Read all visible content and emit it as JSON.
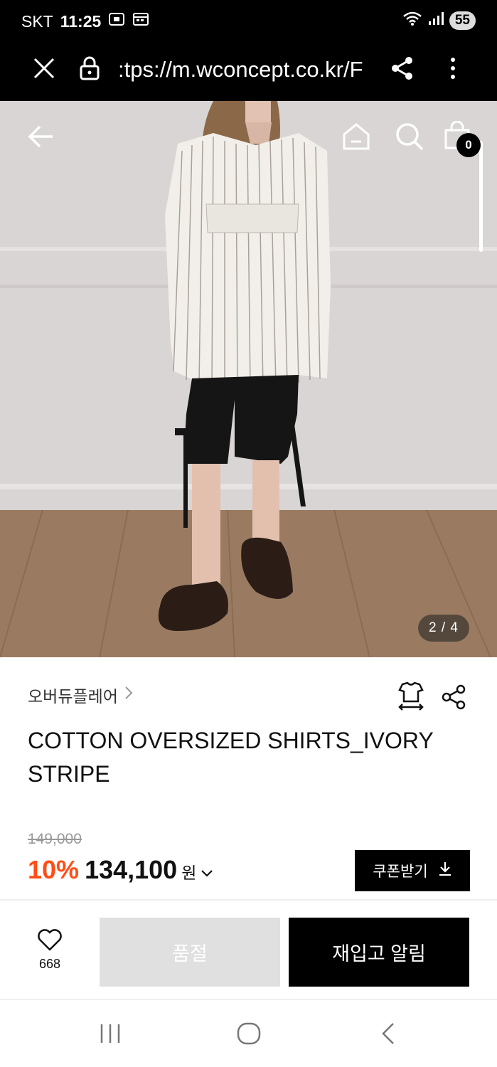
{
  "status_bar": {
    "carrier": "SKT",
    "time": "11:25",
    "battery": "55"
  },
  "browser": {
    "url": ":tps://m.wconcept.co.kr/F"
  },
  "gallery": {
    "counter": "2 / 4",
    "cart_count": "0"
  },
  "product": {
    "brand": "오버듀플레어",
    "title": "COTTON OVERSIZED SHIRTS_IVORY STRIPE",
    "original_price": "149,000",
    "discount": "10%",
    "price": "134,100",
    "currency": "원"
  },
  "actions": {
    "coupon_label": "쿠폰받기",
    "wish_count": "668",
    "soldout_label": "품절",
    "restock_label": "재입고 알림"
  },
  "colors": {
    "accent": "#ff4e16",
    "primary": "#000000",
    "disabled": "#e0e0e0"
  }
}
